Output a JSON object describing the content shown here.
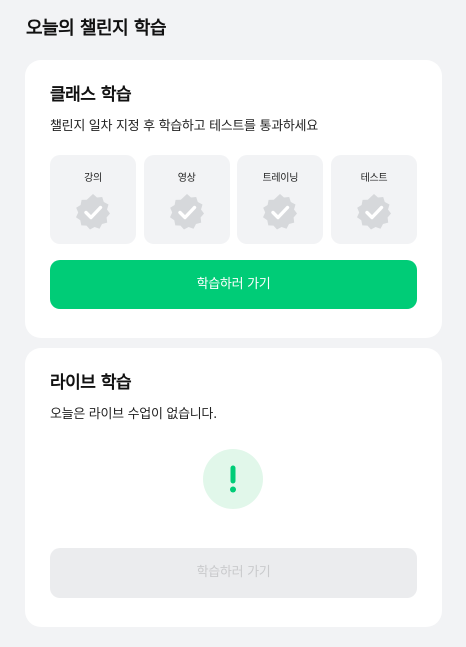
{
  "page": {
    "title": "오늘의 챌린지 학습"
  },
  "class_section": {
    "title": "클래스 학습",
    "description": "챌린지 일차 지정 후 학습하고 테스트를 통과하세요",
    "steps": [
      {
        "label": "강의",
        "icon": "check-badge-icon",
        "completed": false
      },
      {
        "label": "영상",
        "icon": "check-badge-icon",
        "completed": false
      },
      {
        "label": "트레이닝",
        "icon": "check-badge-icon",
        "completed": false
      },
      {
        "label": "테스트",
        "icon": "check-badge-icon",
        "completed": false
      }
    ],
    "button_label": "학습하러 가기"
  },
  "live_section": {
    "title": "라이브 학습",
    "description": "오늘은 라이브 수업이 없습니다.",
    "status_icon": "exclamation-icon",
    "button_label": "학습하러 가기",
    "button_disabled": true
  },
  "colors": {
    "accent": "#00cc77",
    "badge_gray": "#d6d8db",
    "alert_bg": "#e1f7ea",
    "background": "#f2f3f5"
  }
}
